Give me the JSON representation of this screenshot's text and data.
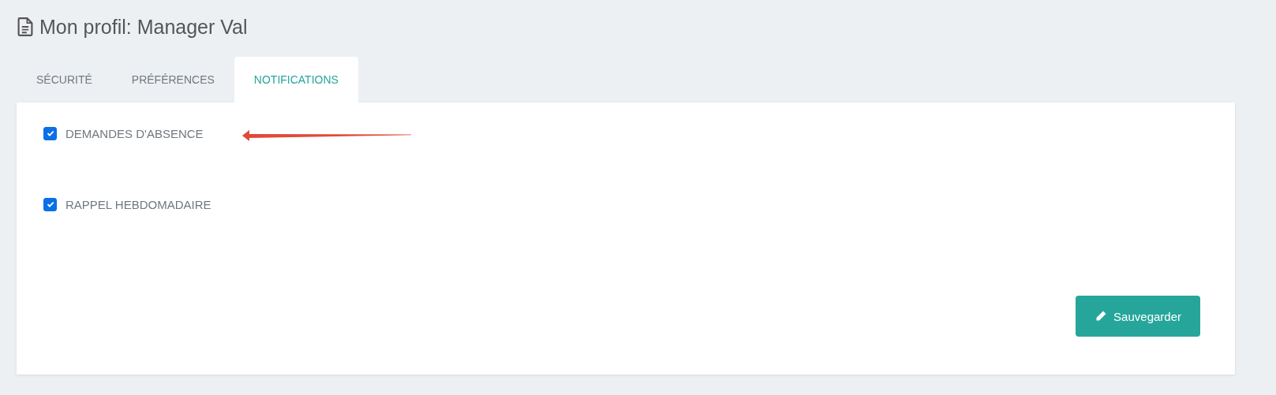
{
  "page_title": "Mon profil: Manager Val",
  "tabs": [
    {
      "label": "SÉCURITÉ",
      "selected": false
    },
    {
      "label": "PRÉFÉRENCES",
      "selected": false
    },
    {
      "label": "NOTIFICATIONS",
      "selected": true
    }
  ],
  "options": [
    {
      "label": "DEMANDES D'ABSENCE",
      "checked": true
    },
    {
      "label": "RAPPEL HEBDOMADAIRE",
      "checked": true
    }
  ],
  "save_button": {
    "label": "Sauvegarder"
  }
}
